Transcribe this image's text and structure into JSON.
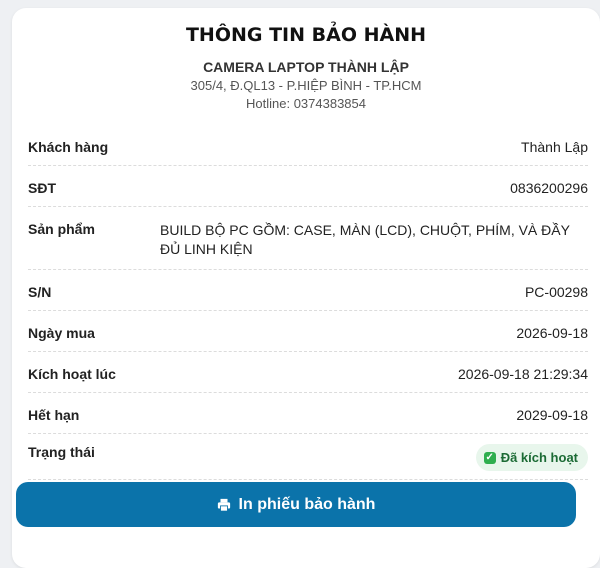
{
  "header": {
    "title": "THÔNG TIN BẢO HÀNH",
    "shop_name": "CAMERA LAPTOP THÀNH LẬP",
    "address": "305/4, Đ.QL13 - P.HIỆP BÌNH - TP.HCM",
    "hotline": "Hotline: 0374383854"
  },
  "details": {
    "customer_label": "Khách hàng",
    "customer_value": "Thành Lập",
    "phone_label": "SĐT",
    "phone_value": "0836200296",
    "product_label": "Sản phẩm",
    "product_value": "BUILD BỘ PC GỒM: CASE, MÀN (LCD), CHUỘT, PHÍM, VÀ ĐẦY ĐỦ LINH KIỆN",
    "serial_label": "S/N",
    "serial_value": "PC-00298",
    "purchase_label": "Ngày mua",
    "purchase_value": "2026-09-18",
    "activated_label": "Kích hoạt lúc",
    "activated_value": "2026-09-18 21:29:34",
    "expiry_label": "Hết hạn",
    "expiry_value": "2029-09-18",
    "status_label": "Trạng thái",
    "status_value": "Đã kích hoạt"
  },
  "actions": {
    "print_label": "In phiếu bảo hành",
    "print_icon": "printer-icon"
  },
  "colors": {
    "accent": "#0b73aa",
    "status_bg": "#e8f6ec",
    "status_check": "#2fae4f"
  }
}
